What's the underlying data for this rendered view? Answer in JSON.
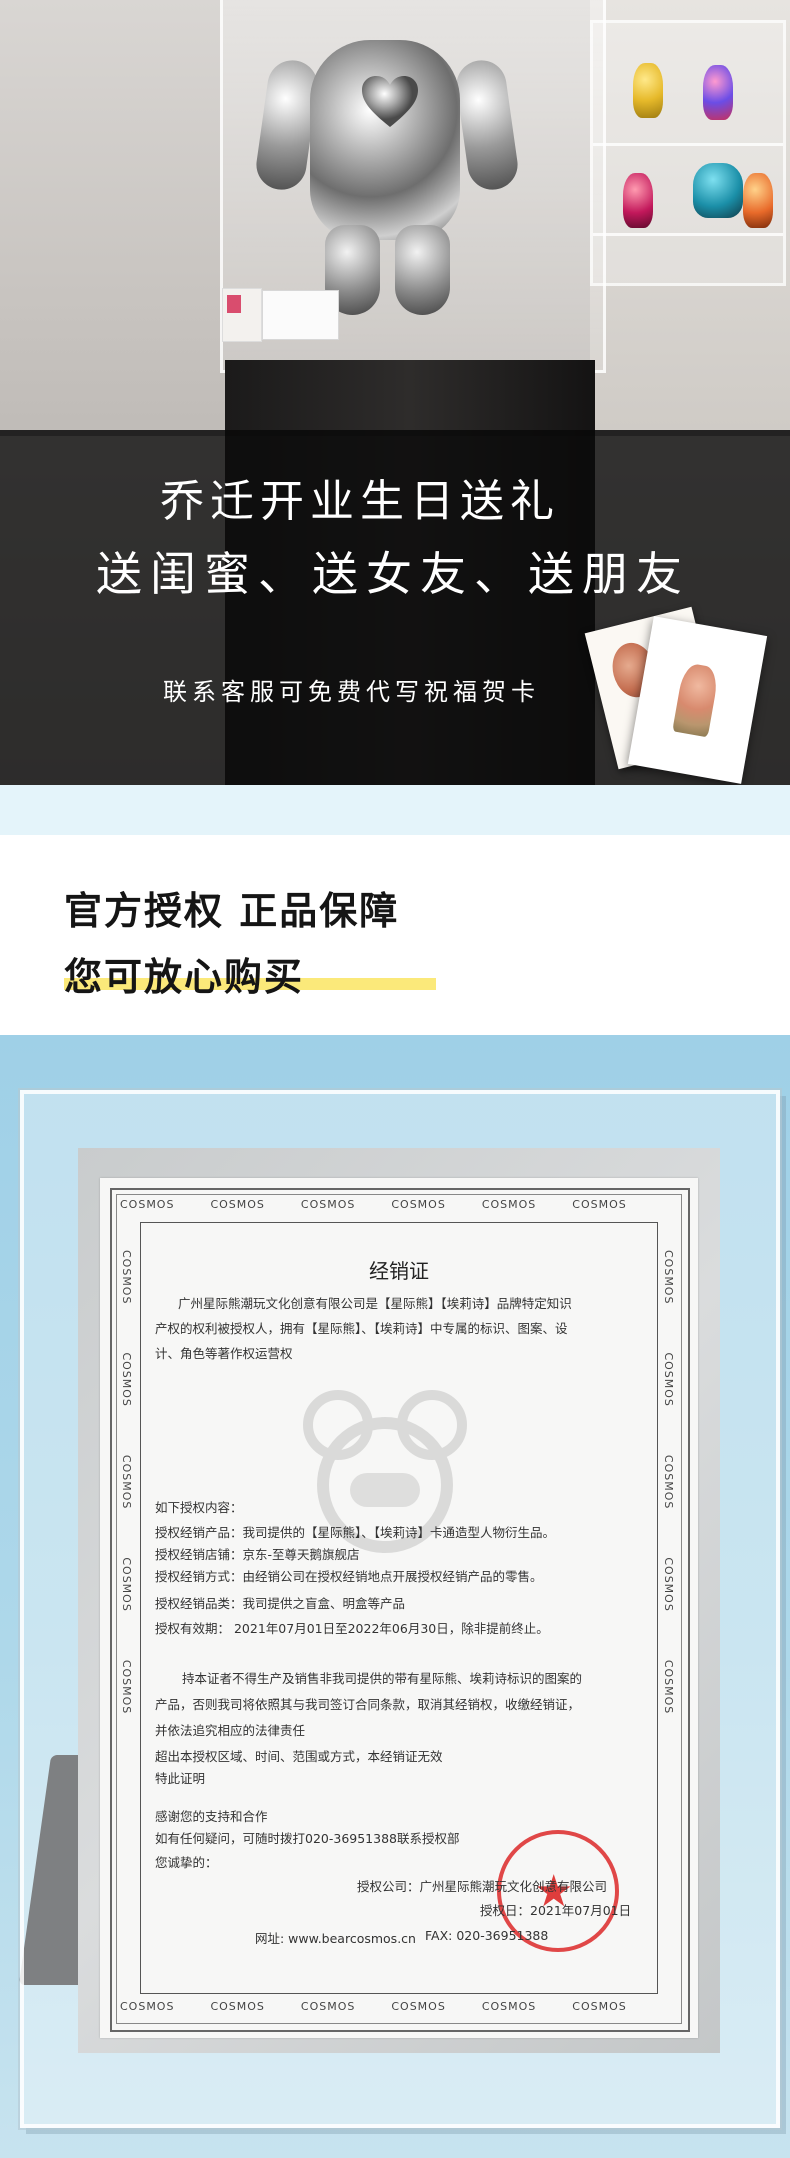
{
  "hero": {
    "line1": "乔迁开业生日送礼",
    "line2": "送闺蜜、送女友、送朋友",
    "subline": "联系客服可免费代写祝福贺卡",
    "colors": {
      "overlay": "#111111",
      "text": "#ffffff"
    }
  },
  "headline": {
    "line1": "官方授权 正品保障",
    "line2": "您可放心购买",
    "highlight_color": "#fbe97a"
  },
  "certificate": {
    "logo_text": "COSMOS",
    "title": "经销证",
    "paragraphs": [
      "广州星际熊潮玩文化创意有限公司是【星际熊】【埃莉诗】品牌特定知识",
      "产权的权利被授权人，拥有【星际熊】、【埃莉诗】中专属的标识、图案、设",
      "计、角色等著作权运营权"
    ],
    "auth_intro": "如下授权内容：",
    "auth_items": [
      "授权经销产品：我司提供的【星际熊】、【埃莉诗】卡通造型人物衍生品。",
      "授权经销店铺：京东-至尊天鹅旗舰店",
      "授权经销方式：由经销公司在授权经销地点开展授权经销产品的零售。",
      "授权经销品类：我司提供之盲盒、明盒等产品",
      "授权有效期：   2021年07月01日至2022年06月30日，除非提前终止。"
    ],
    "notice": [
      "持本证者不得生产及销售非我司提供的带有星际熊、埃莉诗标识的图案的",
      "产品，否则我司将依照其与我司签订合同条款，取消其经销权，收缴经销证，",
      "并依法追究相应的法律责任",
      "超出本授权区域、时间、范围或方式，本经销证无效",
      "特此证明"
    ],
    "thanks": [
      "感谢您的支持和合作",
      "如有任何疑问，可随时拨打020-36951388联系授权部",
      "您诚挚的："
    ],
    "issuer": "授权公司：广州星际熊潮玩文化创意有限公司",
    "date": "授权日：2021年07月01日",
    "website": "网址: www.bearcosmos.cn",
    "fax": "FAX: 020-36951388",
    "seal_color": "#dc2828"
  }
}
